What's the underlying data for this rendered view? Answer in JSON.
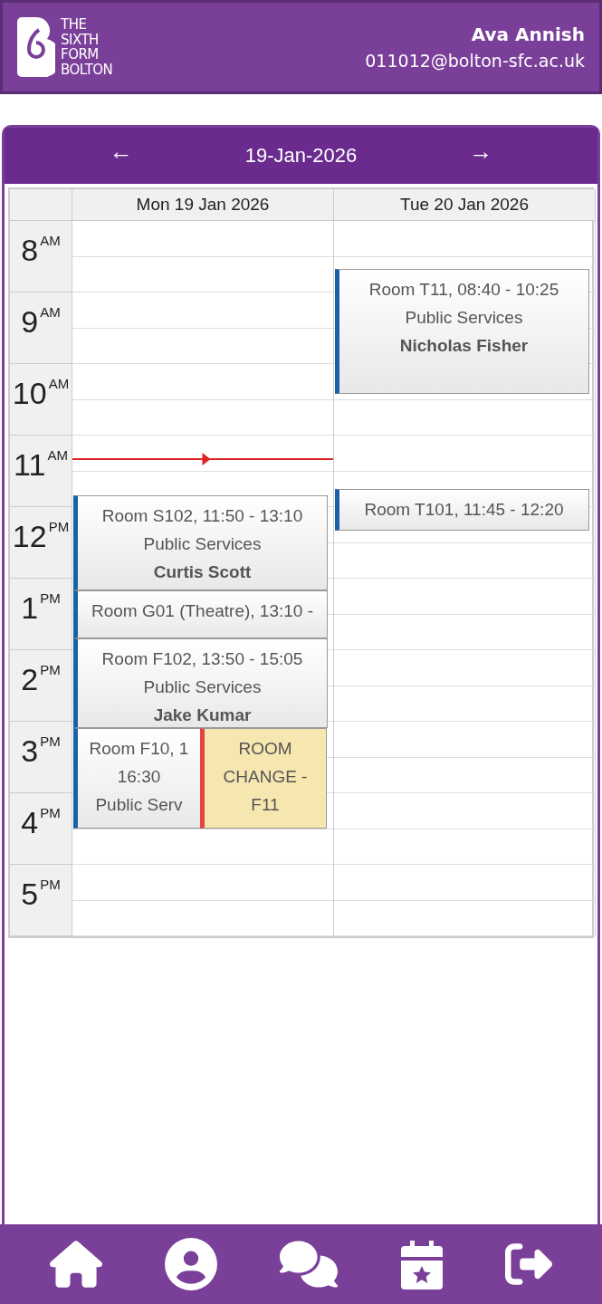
{
  "header": {
    "logo_lines": [
      "THE",
      "SIXTH",
      "FORM",
      "BOLTON"
    ],
    "user_name": "Ava Annish",
    "email": "011012@bolton-sfc.ac.uk"
  },
  "calendar": {
    "prev": "←",
    "date": "19-Jan-2026",
    "next": "→",
    "hours": [
      {
        "hour": "8",
        "period": "AM"
      },
      {
        "hour": "9",
        "period": "AM"
      },
      {
        "hour": "10",
        "period": "AM"
      },
      {
        "hour": "11",
        "period": "AM"
      },
      {
        "hour": "12",
        "period": "PM"
      },
      {
        "hour": "1",
        "period": "PM"
      },
      {
        "hour": "2",
        "period": "PM"
      },
      {
        "hour": "3",
        "period": "PM"
      },
      {
        "hour": "4",
        "period": "PM"
      },
      {
        "hour": "5",
        "period": "PM"
      }
    ],
    "days": [
      {
        "label": "Mon 19 Jan 2026",
        "now_line": true,
        "events": [
          {
            "kind": "lesson",
            "lines": [
              "Room S102, 11:50 - 13:10",
              "Public Services"
            ],
            "teacher": "Curtis Scott"
          },
          {
            "kind": "lesson",
            "lines": [
              "Room G01 (Theatre), 13:10 -"
            ]
          },
          {
            "kind": "lesson",
            "lines": [
              "Room F102, 13:50 - 15:05",
              "Public Services"
            ],
            "teacher": "Jake Kumar"
          },
          {
            "kind": "lesson",
            "lines": [
              "Room F10, 1",
              "16:30",
              "Public Serv"
            ]
          },
          {
            "kind": "notice",
            "lines": [
              "ROOM",
              "CHANGE -",
              "F11"
            ]
          }
        ]
      },
      {
        "label": "Tue 20 Jan 2026",
        "now_line": false,
        "events": [
          {
            "kind": "lesson",
            "lines": [
              "Room T11, 08:40 - 10:25",
              "Public Services"
            ],
            "teacher": "Nicholas Fisher"
          },
          {
            "kind": "lesson",
            "lines": [
              "Room T101, 11:45 - 12:20"
            ]
          }
        ]
      }
    ]
  },
  "nav": [
    {
      "kind": "home"
    },
    {
      "kind": "profile"
    },
    {
      "kind": "messages"
    },
    {
      "kind": "timetable"
    },
    {
      "kind": "logout"
    }
  ]
}
